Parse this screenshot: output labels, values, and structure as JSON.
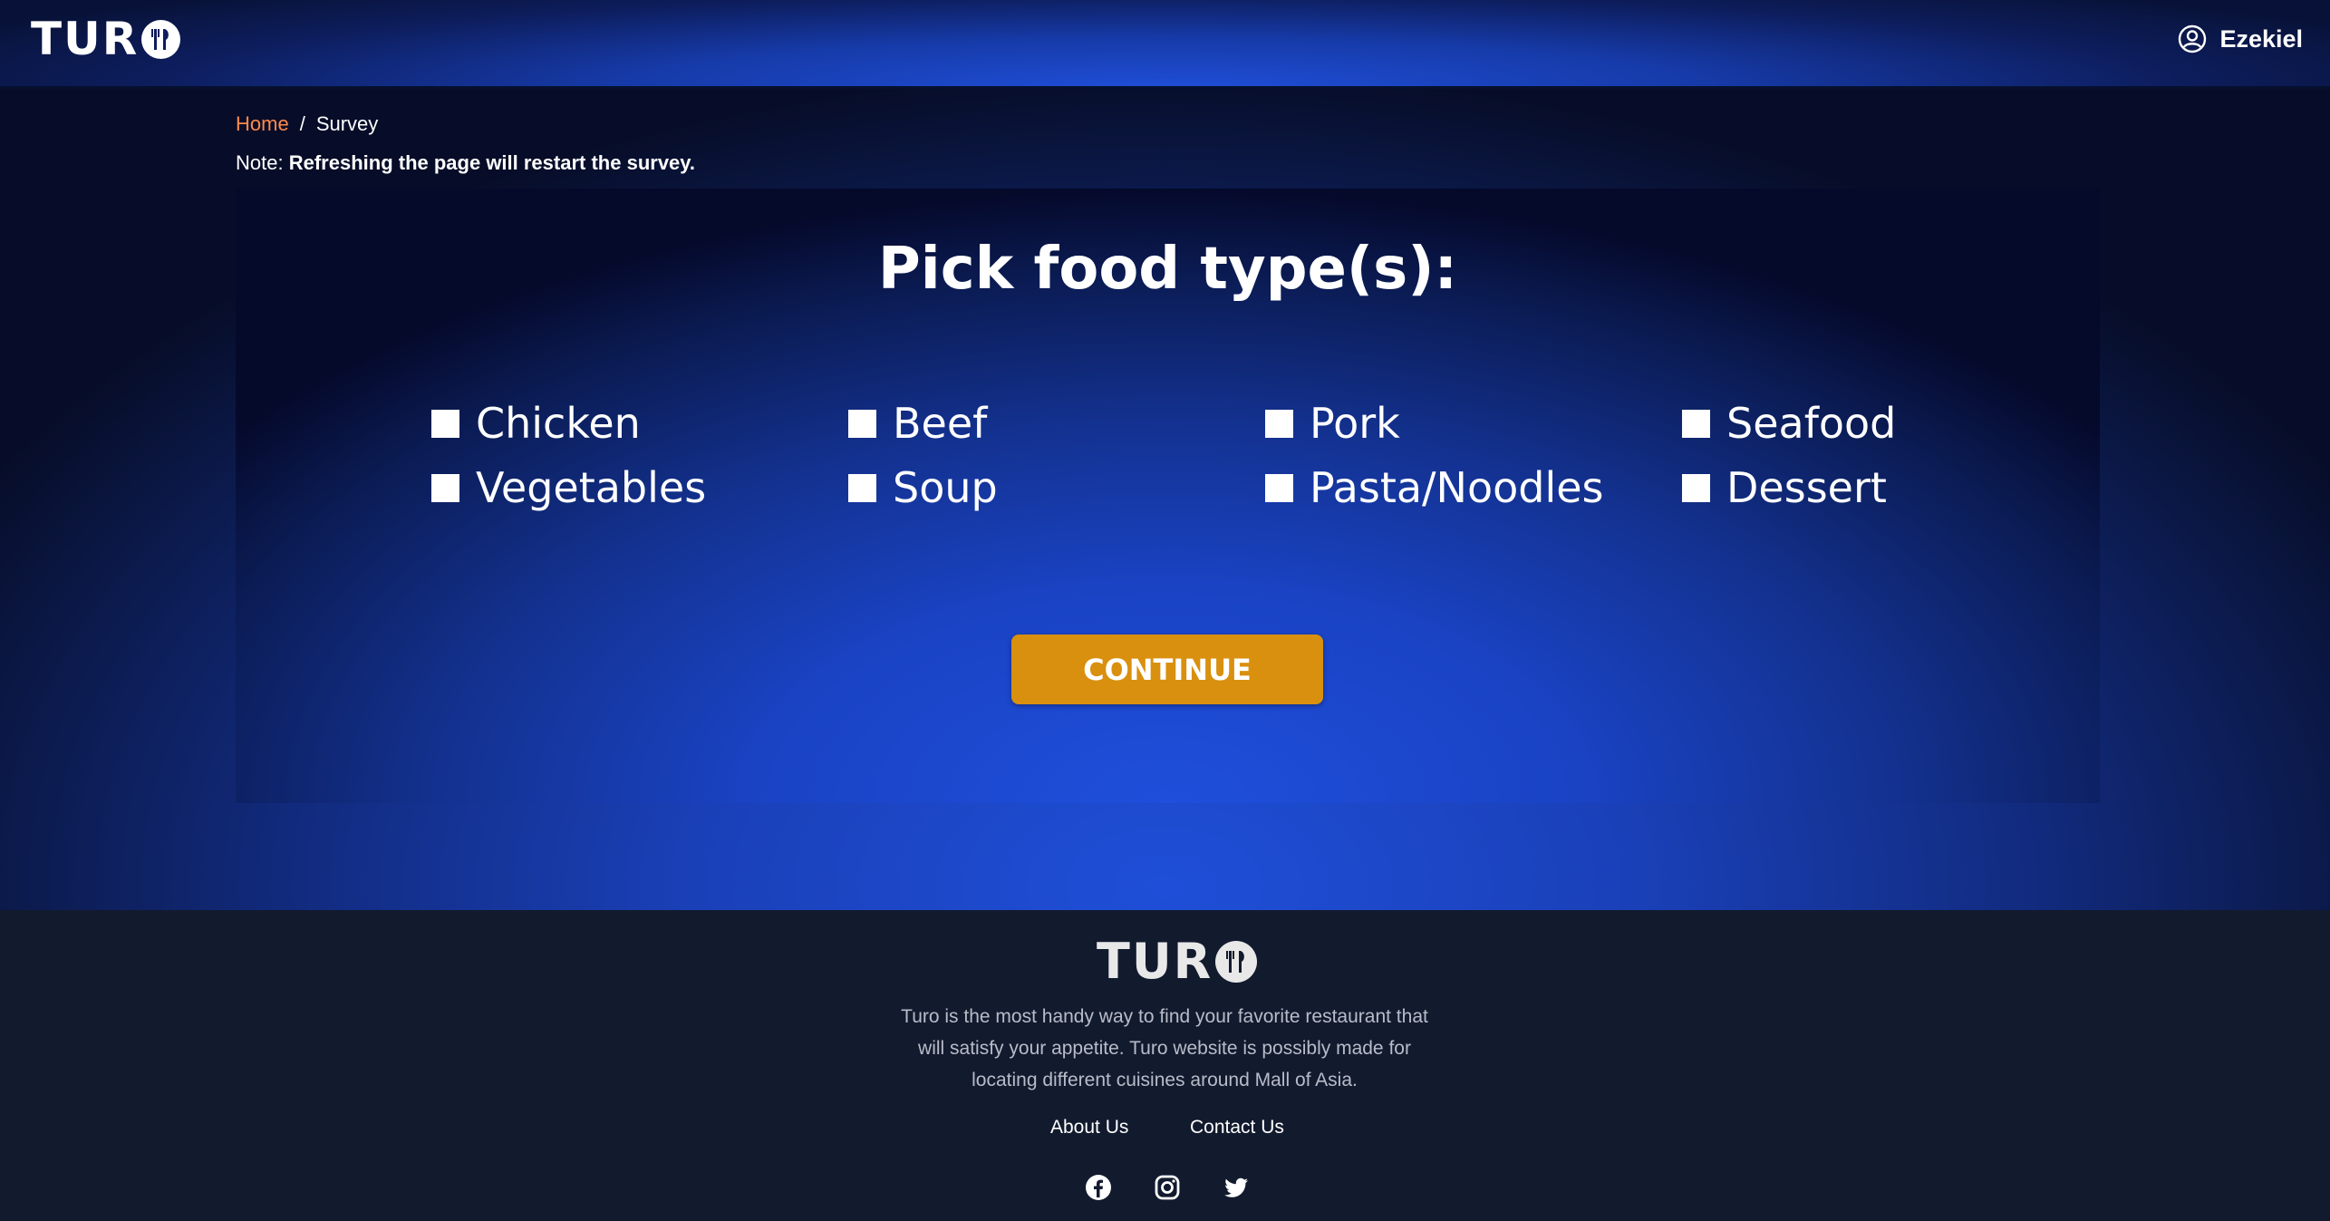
{
  "header": {
    "logo_text": "TUR",
    "user_name": "Ezekiel"
  },
  "breadcrumb": {
    "home": "Home",
    "separator": "/",
    "current": "Survey"
  },
  "note": {
    "prefix": "Note:",
    "text": "Refreshing the page will restart the survey."
  },
  "survey": {
    "title": "Pick food type(s):",
    "options": [
      {
        "label": "Chicken",
        "checked": false
      },
      {
        "label": "Beef",
        "checked": false
      },
      {
        "label": "Pork",
        "checked": false
      },
      {
        "label": "Seafood",
        "checked": false
      },
      {
        "label": "Vegetables",
        "checked": false
      },
      {
        "label": "Soup",
        "checked": false
      },
      {
        "label": "Pasta/Noodles",
        "checked": false
      },
      {
        "label": "Dessert",
        "checked": false
      }
    ],
    "continue_label": "CONTINUE"
  },
  "footer": {
    "logo_text": "TUR",
    "description_lines": [
      "Turo is the most handy way to find your favorite restaurant that",
      "will satisfy your appetite. Turo website is possibly made for",
      "locating different cuisines around Mall of Asia."
    ],
    "links": [
      "About Us",
      "Contact Us"
    ],
    "social_icons": [
      "facebook-icon",
      "instagram-icon",
      "twitter-icon"
    ]
  },
  "colors": {
    "accent_orange": "#d9900e",
    "breadcrumb_link": "#ff8a4c",
    "footer_bg": "#121a2e"
  }
}
